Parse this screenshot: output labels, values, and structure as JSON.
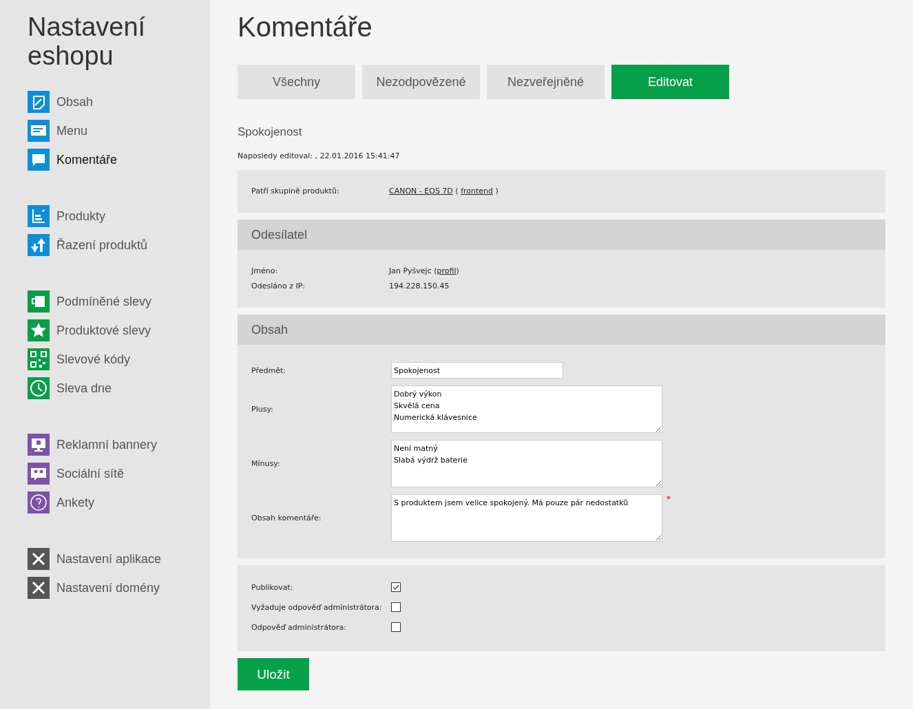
{
  "sidebar": {
    "title": "Nastavení eshopu",
    "groups": [
      {
        "color": "#0f8ed8",
        "items": [
          {
            "label": "Obsah",
            "selected": false
          },
          {
            "label": "Menu",
            "selected": false
          },
          {
            "label": "Komentáře",
            "selected": true
          }
        ]
      },
      {
        "color": "#0f8ed8",
        "items": [
          {
            "label": "Produkty",
            "selected": false
          },
          {
            "label": "Řazení produktů",
            "selected": false
          }
        ]
      },
      {
        "color": "#0a9d4a",
        "items": [
          {
            "label": "Podmíněné slevy",
            "selected": false
          },
          {
            "label": "Produktové slevy",
            "selected": false
          },
          {
            "label": "Slevové kódy",
            "selected": false
          },
          {
            "label": "Sleva dne",
            "selected": false
          }
        ]
      },
      {
        "color": "#7b54a8",
        "items": [
          {
            "label": "Reklamní bannery",
            "selected": false
          },
          {
            "label": "Sociální sítě",
            "selected": false
          },
          {
            "label": "Ankety",
            "selected": false
          }
        ]
      },
      {
        "color": "#555555",
        "items": [
          {
            "label": "Nastavení aplikace",
            "selected": false
          },
          {
            "label": "Nastavení domény",
            "selected": false
          }
        ]
      }
    ]
  },
  "page_title": "Komentáře",
  "tabs": [
    {
      "label": "Všechny",
      "selected": false
    },
    {
      "label": "Nezodpovězené",
      "selected": false
    },
    {
      "label": "Nezveřejněné",
      "selected": false
    },
    {
      "label": "Editovat",
      "selected": true
    }
  ],
  "comment_title": "Spokojenost",
  "last_edited": "Naposledy editoval: , 22.01.2016 15:41:47",
  "product_group": {
    "label": "Patří skupině produktů:",
    "parts": [
      {
        "text": "CANON - EOS 7D",
        "link": true
      },
      {
        "text": " ( ",
        "link": false
      },
      {
        "text": "frontend",
        "link": true
      },
      {
        "text": " )",
        "link": false
      }
    ]
  },
  "sender": {
    "heading": "Odesílatel",
    "rows": [
      {
        "label": "Jméno:",
        "parts": [
          {
            "text": "Jan Pyšvejc (",
            "link": false
          },
          {
            "text": "profil",
            "link": true
          },
          {
            "text": ")",
            "link": false
          }
        ]
      },
      {
        "label": "Odesláno z IP:",
        "parts": [
          {
            "text": "194.228.150.45",
            "link": false
          }
        ]
      }
    ]
  },
  "content": {
    "heading": "Obsah",
    "fields": [
      {
        "kind": "input",
        "label": "Předmět:",
        "value": "Spokojenost"
      },
      {
        "kind": "textarea",
        "label": "Plusy:",
        "lines": [
          "Dobrý výkon",
          "Skvělá cena",
          "Numerická klávesnice"
        ]
      },
      {
        "kind": "textarea",
        "label": "Mínusy:",
        "lines": [
          "Není matný",
          "Slabá výdrž baterie"
        ]
      },
      {
        "kind": "textarea",
        "label": "Obsah komentáře:",
        "lines": [
          "S produktem jsem velice spokojený. Má pouze pár nedostatků"
        ],
        "required_mark": "*"
      }
    ]
  },
  "options": [
    {
      "label": "Publikovat:",
      "checked": true
    },
    {
      "label": "Vyžaduje odpověď administrátora:",
      "checked": false
    },
    {
      "label": "Odpověď administrátora:",
      "checked": false
    }
  ],
  "save_button": "Uložit"
}
